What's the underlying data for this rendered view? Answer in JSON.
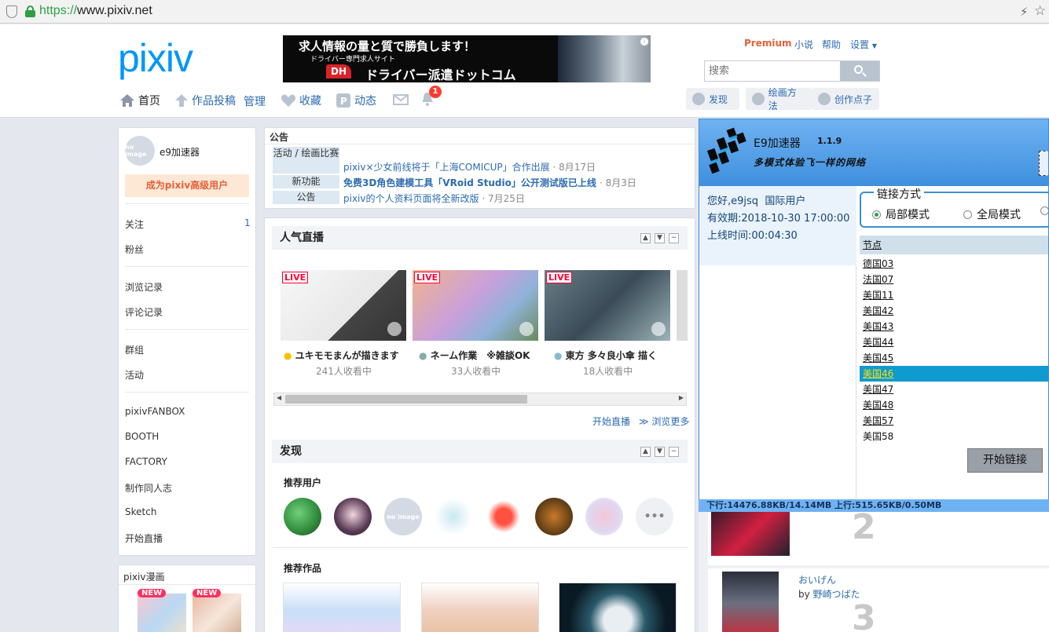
{
  "browser": {
    "url_scheme": "https://",
    "url_rest": "www.pixiv.net"
  },
  "header": {
    "logo": "pixiv",
    "ad": {
      "line1": "求人情報の量と質で勝負します！",
      "line2": "ドライバー専門求人サイト",
      "badge": "DH",
      "line3": "ドライバー派遣ドットコム"
    },
    "toplinks": {
      "premium": "Premium",
      "novel": "小说",
      "help": "帮助",
      "settings": "设置"
    },
    "search_placeholder": "搜索",
    "nav": {
      "home": "首页",
      "post": "作品投稿",
      "manage": "管理",
      "bookmark": "收藏",
      "feed": "动态",
      "notif_count": "1"
    },
    "right_nav": {
      "discover": "发现",
      "howto": "绘画方法",
      "ideas": "创作点子"
    }
  },
  "left": {
    "username": "e9加速器",
    "noimage": "no image",
    "become_premium": "成为pixiv高级用户",
    "follow": "关注",
    "follow_count": "1",
    "fans": "粉丝",
    "history": "浏览记录",
    "comments": "评论记录",
    "groups": "群组",
    "events": "活动",
    "fanbox": "pixivFANBOX",
    "booth": "BOOTH",
    "factory": "FACTORY",
    "doujin": "制作同人志",
    "sketch": "Sketch",
    "live": "开始直播",
    "manga_title": "pixiv漫画",
    "new_badge": "NEW"
  },
  "announcements": {
    "title": "公告",
    "items": [
      {
        "tag": "活动 / 绘画比赛",
        "text": "pixiv×少女前线将于「上海COMICUP」合作出展",
        "date": "· 8月17日"
      },
      {
        "tag": "新功能",
        "text": "免费3D角色建模工具「VRoid Studio」公开测试版已上线",
        "date": "· 8月3日"
      },
      {
        "tag": "公告",
        "text": "pixiv的个人资料页面将全新改版",
        "date": "· 7月25日"
      }
    ]
  },
  "live": {
    "title": "人气直播",
    "badge": "LIVE",
    "items": [
      {
        "title": "ユキモモまんが描きます",
        "viewers": "241人收看中"
      },
      {
        "title": "ネーム作業　※雑談OK",
        "viewers": "33人收看中"
      },
      {
        "title": "東方 多々良小傘 描く",
        "viewers": "18人收看中"
      }
    ],
    "start": "开始直播",
    "more": "≫ 浏览更多"
  },
  "discover": {
    "title": "发现",
    "rec_users": "推荐用户",
    "rec_works": "推荐作品",
    "more": "•••"
  },
  "popup": {
    "name": "E9加速器",
    "version": "1.1.9",
    "subtitle": "多模式体验飞一样的网络",
    "greeting": "您好,e9jsq",
    "user_type": "国际用户",
    "expiry": "有效期:2018-10-30 17:00:00",
    "online": "上线时间:00:04:30",
    "mode_title": "链接方式",
    "mode_local": "局部模式",
    "mode_global": "全局模式",
    "node_header": "节点",
    "nodes": [
      "德国03",
      "法国07",
      "美国11",
      "美国42",
      "美国43",
      "美国44",
      "美国45",
      "美国46",
      "美国47",
      "美国48",
      "美国57",
      "美国58"
    ],
    "selected_node": "美国46",
    "start": "开始链接",
    "status": "下行:14476.88KB/14.14MB 上行:515.65KB/0.50MB"
  },
  "ranking": {
    "rank2": "2",
    "rank3": "3",
    "title3": "おいげん",
    "by": "by",
    "author3": "野崎つばた"
  },
  "colors": {
    "pixiv_blue": "#0096fa",
    "link": "#2c6bb0",
    "premium": "#e5603a",
    "selected_node": "#0f9ad0"
  }
}
